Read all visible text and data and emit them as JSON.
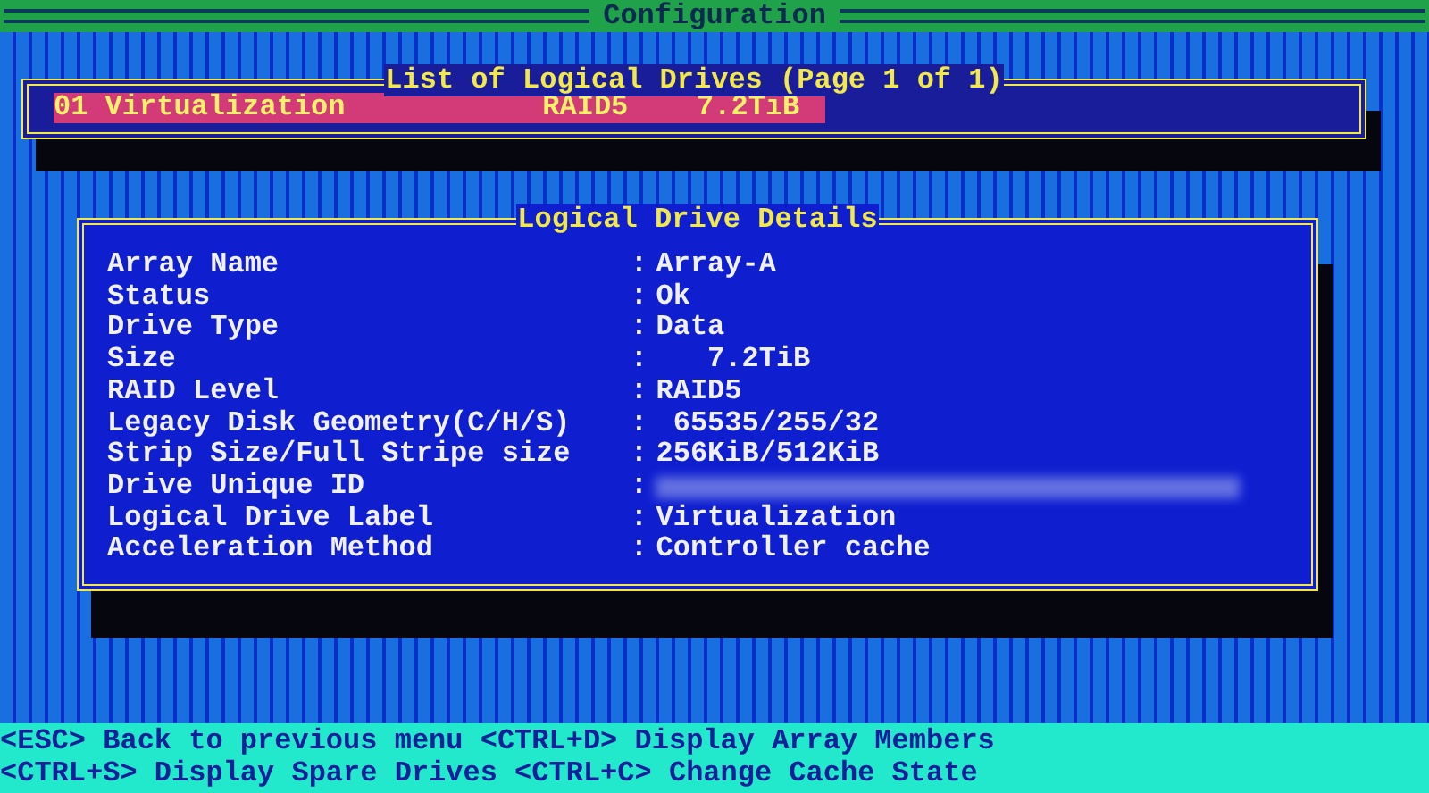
{
  "title_bar": {
    "title": "Configuration"
  },
  "drive_list": {
    "title": "List of Logical Drives (Page 1 of 1)",
    "rows": [
      {
        "name": "01 Virtualization",
        "raid": "RAID5",
        "size": "7.2TiB",
        "selected": true
      }
    ]
  },
  "details": {
    "title": "Logical Drive Details",
    "rows": [
      {
        "label": "Array Name",
        "separator": ":",
        "value": "Array-A"
      },
      {
        "label": "Status",
        "separator": ":",
        "value": "Ok"
      },
      {
        "label": "Drive Type",
        "separator": ":",
        "value": "Data"
      },
      {
        "label": "Size",
        "separator": ":",
        "value": "   7.2TiB"
      },
      {
        "label": "RAID Level",
        "separator": ":",
        "value": "RAID5"
      },
      {
        "label": "Legacy Disk Geometry(C/H/S)",
        "separator": ":",
        "value": " 65535/255/32"
      },
      {
        "label": "Strip Size/Full Stripe size",
        "separator": ":",
        "value": "256KiB/512KiB"
      },
      {
        "label": "Drive Unique ID",
        "separator": ":"
      },
      {
        "label": "Logical Drive Label",
        "separator": ":",
        "value": "Virtualization"
      },
      {
        "label": "Acceleration Method",
        "separator": ":",
        "value": "Controller cache"
      }
    ]
  },
  "help_bar": {
    "lines": [
      "<ESC> Back to previous menu <CTRL+D> Display Array Members",
      "<CTRL+S> Display Spare Drives <CTRL+C> Change Cache State"
    ]
  }
}
